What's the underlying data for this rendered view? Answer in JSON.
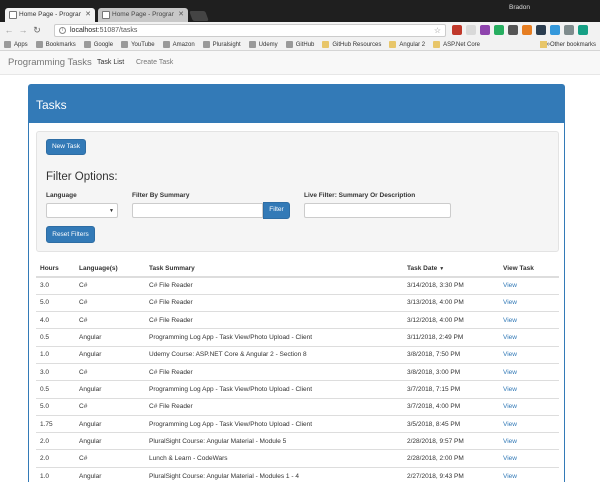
{
  "browser": {
    "tabs": [
      {
        "title": "Home Page - Programm",
        "active": true
      },
      {
        "title": "Home Page - Programm",
        "active": false
      }
    ],
    "profile_name": "Bradon",
    "url_host": "localhost",
    "url_path": ":51087/tasks",
    "bookmarks": [
      {
        "label": "Apps",
        "icon": "apps-grid-icon"
      },
      {
        "label": "Bookmarks",
        "icon": "star-icon"
      },
      {
        "label": "Google",
        "icon": "google-icon"
      },
      {
        "label": "YouTube",
        "icon": "youtube-icon"
      },
      {
        "label": "Amazon",
        "icon": "amazon-icon"
      },
      {
        "label": "Pluralsight",
        "icon": "pluralsight-icon"
      },
      {
        "label": "Udemy",
        "icon": "udemy-icon"
      },
      {
        "label": "GitHub",
        "icon": "github-icon"
      },
      {
        "label": "GitHub Resources",
        "icon": "folder-icon"
      },
      {
        "label": "Angular 2",
        "icon": "folder-icon"
      },
      {
        "label": "ASP.Net Core",
        "icon": "folder-icon"
      }
    ],
    "bookmarks_more": "»",
    "other_bookmarks": "Other bookmarks",
    "extension_colors": [
      "#c0392b",
      "#d9d9d9",
      "#8e44ad",
      "#27ae60",
      "#555555",
      "#e67e22",
      "#2c3e50",
      "#3498db",
      "#7f8c8d",
      "#16a085"
    ]
  },
  "navbar": {
    "brand": "Programming Tasks",
    "links": [
      {
        "label": "Task List",
        "active": true
      },
      {
        "label": "Create Task",
        "active": false
      }
    ]
  },
  "panel": {
    "title": "Tasks",
    "accent_color": "#337ab7"
  },
  "filters": {
    "new_task_label": "New Task",
    "heading": "Filter Options:",
    "language_label": "Language",
    "language_value": "",
    "summary_label": "Filter By Summary",
    "summary_value": "",
    "filter_button": "Filter",
    "live_label": "Live Filter: Summary Or Description",
    "live_value": "",
    "reset_label": "Reset Filters"
  },
  "table": {
    "columns": [
      "Hours",
      "Language(s)",
      "Task Summary",
      "Task Date",
      "View Task"
    ],
    "sort_indicator": "▼",
    "rows": [
      {
        "hours": "3.0",
        "language": "C#",
        "summary": "C# File Reader",
        "date": "3/14/2018, 3:30 PM",
        "view": "View"
      },
      {
        "hours": "5.0",
        "language": "C#",
        "summary": "C# File Reader",
        "date": "3/13/2018, 4:00 PM",
        "view": "View"
      },
      {
        "hours": "4.0",
        "language": "C#",
        "summary": "C# File Reader",
        "date": "3/12/2018, 4:00 PM",
        "view": "View"
      },
      {
        "hours": "0.5",
        "language": "Angular",
        "summary": "Programming Log App - Task View/Photo Upload - Client",
        "date": "3/11/2018, 2:49 PM",
        "view": "View"
      },
      {
        "hours": "1.0",
        "language": "Angular",
        "summary": "Udemy Course: ASP.NET Core & Angular 2 - Section 8",
        "date": "3/8/2018, 7:50 PM",
        "view": "View"
      },
      {
        "hours": "3.0",
        "language": "C#",
        "summary": "C# File Reader",
        "date": "3/8/2018, 3:00 PM",
        "view": "View"
      },
      {
        "hours": "0.5",
        "language": "Angular",
        "summary": "Programming Log App - Task View/Photo Upload - Client",
        "date": "3/7/2018, 7:15 PM",
        "view": "View"
      },
      {
        "hours": "5.0",
        "language": "C#",
        "summary": "C# File Reader",
        "date": "3/7/2018, 4:00 PM",
        "view": "View"
      },
      {
        "hours": "1.75",
        "language": "Angular",
        "summary": "Programming Log App - Task View/Photo Upload - Client",
        "date": "3/5/2018, 8:45 PM",
        "view": "View"
      },
      {
        "hours": "2.0",
        "language": "Angular",
        "summary": "PluralSight Course: Angular Material - Module 5",
        "date": "2/28/2018, 9:57 PM",
        "view": "View"
      },
      {
        "hours": "2.0",
        "language": "C#",
        "summary": "Lunch & Learn - CodeWars",
        "date": "2/28/2018, 2:00 PM",
        "view": "View"
      },
      {
        "hours": "1.0",
        "language": "Angular",
        "summary": "PluralSight Course: Angular Material - Modules 1 - 4",
        "date": "2/27/2018, 9:43 PM",
        "view": "View"
      }
    ]
  }
}
